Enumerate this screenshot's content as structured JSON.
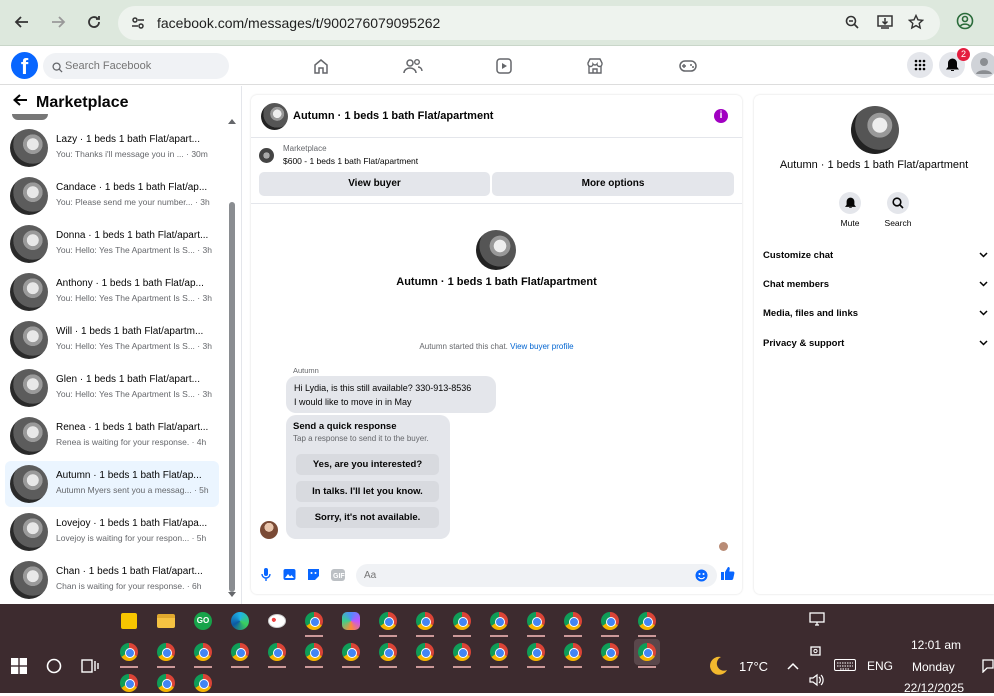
{
  "browser": {
    "url": "facebook.com/messages/t/900276079095262"
  },
  "facebook": {
    "logo": "f",
    "search_placeholder": "Search Facebook",
    "notification_count": "2"
  },
  "left_panel": {
    "title": "Marketplace",
    "conversations": [
      {
        "name": "Lazy · 1 beds 1 bath Flat/apart...",
        "preview": "You: Thanks i'll message you in ... · 30m"
      },
      {
        "name": "Candace · 1 beds 1 bath Flat/ap...",
        "preview": "You: Please send me your number... · 3h"
      },
      {
        "name": "Donna · 1 beds 1 bath Flat/apart...",
        "preview": "You: Hello: Yes The Apartment Is S... · 3h"
      },
      {
        "name": "Anthony · 1 beds 1 bath Flat/ap...",
        "preview": "You: Hello: Yes The Apartment Is S... · 3h"
      },
      {
        "name": "Will · 1 beds 1 bath Flat/apartm...",
        "preview": "You: Hello: Yes The Apartment Is S... · 3h"
      },
      {
        "name": "Glen · 1 beds 1 bath Flat/apart...",
        "preview": "You: Hello: Yes The Apartment Is S... · 3h"
      },
      {
        "name": "Renea · 1 beds 1 bath Flat/apart...",
        "preview": "Renea is waiting for your response. · 4h"
      },
      {
        "name": "Autumn · 1 beds 1 bath Flat/ap...",
        "preview": "Autumn Myers sent you a messag... · 5h"
      },
      {
        "name": "Lovejoy · 1 beds 1 bath Flat/apa...",
        "preview": "Lovejoy is waiting for your respon... · 5h"
      },
      {
        "name": "Chan · 1 beds 1 bath Flat/apart...",
        "preview": "Chan is waiting for your response. · 6h"
      }
    ]
  },
  "chat": {
    "title": "Autumn · 1 beds 1 bath Flat/apartment",
    "marketplace_label": "Marketplace",
    "listing": "$600 - 1 beds 1 bath Flat/apartment",
    "view_buyer": "View buyer",
    "more_options": "More options",
    "intro_title": "Autumn · 1 beds 1 bath Flat/apartment",
    "started_text": "Autumn started this chat.",
    "started_link": "View buyer profile",
    "sender": "Autumn",
    "message_line1": "Hi Lydia, is this still available? 330-913-8536",
    "message_line2": "I would like to move in in May",
    "quick_title": "Send a quick response",
    "quick_sub": "Tap a response to send it to the buyer.",
    "quick_options": [
      "Yes, are you interested?",
      "In talks. I'll let you know.",
      "Sorry, it's not available."
    ],
    "composer_placeholder": "Aa"
  },
  "right_panel": {
    "title": "Autumn · 1 beds 1 bath Flat/apartment",
    "mute": "Mute",
    "search": "Search",
    "rows": [
      "Customize chat",
      "Chat members",
      "Media, files and links",
      "Privacy & support"
    ]
  },
  "taskbar": {
    "temperature": "17°C",
    "language": "ENG",
    "time": "12:01 am",
    "day": "Monday",
    "date": "22/12/2025"
  },
  "colors": {
    "facebook_blue": "#0866ff",
    "info_purple": "#a100c2",
    "taskbar": "#3d2b2f"
  }
}
